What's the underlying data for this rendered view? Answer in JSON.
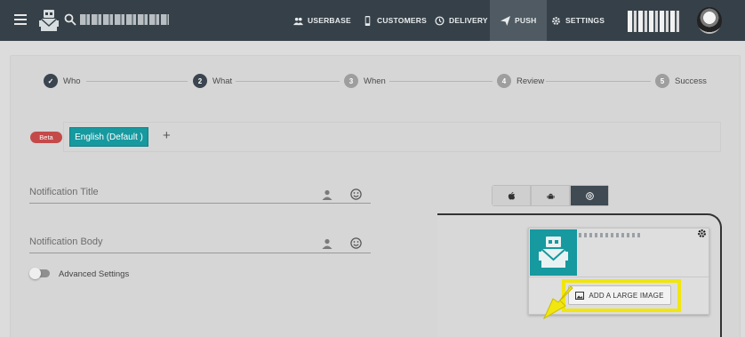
{
  "topbar": {
    "brand_name": "",
    "nav": [
      {
        "label": "USERBASE",
        "icon": "users-icon"
      },
      {
        "label": "CUSTOMERS",
        "icon": "phone-icon"
      },
      {
        "label": "DELIVERY",
        "icon": "history-icon"
      },
      {
        "label": "PUSH",
        "icon": "send-icon",
        "active": true
      },
      {
        "label": "SETTINGS",
        "icon": "gear-icon"
      }
    ],
    "user_name": ""
  },
  "wizard": {
    "steps": [
      {
        "label": "Who",
        "marker": "✓",
        "state": "done"
      },
      {
        "label": "What",
        "marker": "2",
        "state": "current"
      },
      {
        "label": "When",
        "marker": "3",
        "state": "todo"
      },
      {
        "label": "Review",
        "marker": "4",
        "state": "todo"
      },
      {
        "label": "Success",
        "marker": "5",
        "state": "todo"
      }
    ]
  },
  "language": {
    "badge": "Beta",
    "selected": "English (Default )",
    "add_symbol": "+"
  },
  "form": {
    "title_placeholder": "Notification Title",
    "body_placeholder": "Notification Body",
    "advanced_label": "Advanced Settings",
    "advanced_enabled": false
  },
  "preview": {
    "platforms": [
      "ios",
      "android",
      "chrome"
    ],
    "active_platform": "chrome",
    "notification_text": "",
    "add_image_label": "ADD A LARGE IMAGE"
  },
  "colors": {
    "topbar": "#364048",
    "accent_teal": "#16999f",
    "beta_red": "#c44a4a",
    "highlight_yellow": "#f1e60f"
  }
}
